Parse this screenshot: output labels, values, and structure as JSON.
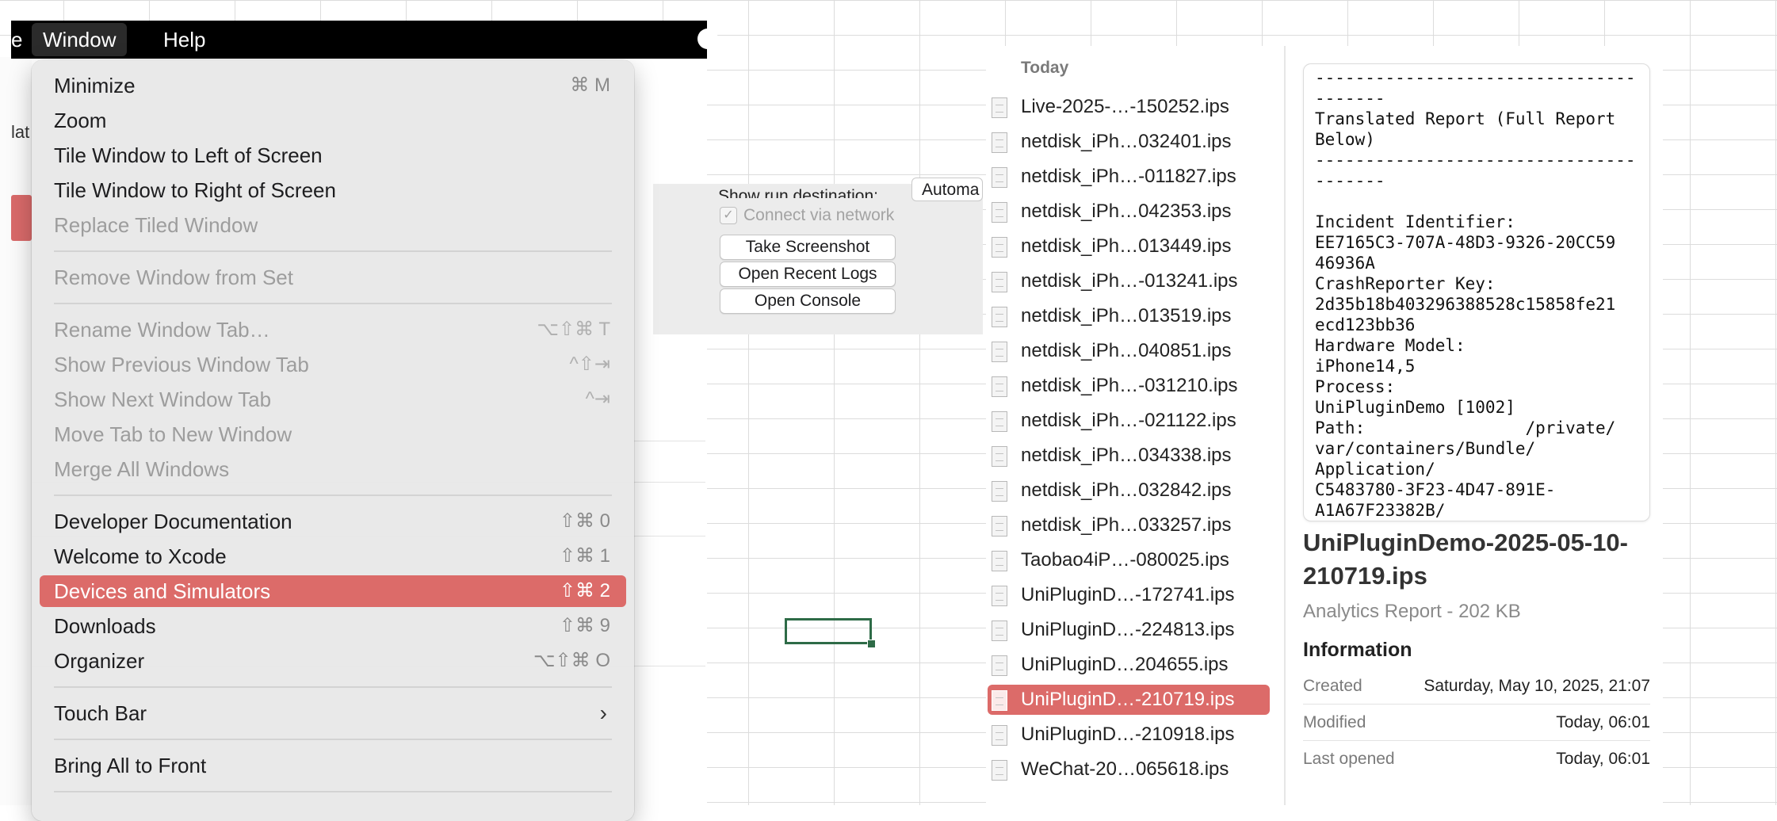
{
  "menubar": {
    "partial_left": "e",
    "window_label": "Window",
    "help_label": "Help"
  },
  "under_window": {
    "partial_label": "lat"
  },
  "device_panel": {
    "run_destination_label": "Show run destination:",
    "run_destination_value": "Automa",
    "connect_label": "Connect via network",
    "buttons": [
      "Take Screenshot",
      "Open Recent Logs",
      "Open Console"
    ]
  },
  "window_menu": {
    "items": [
      {
        "label": "Minimize",
        "shortcut": "⌘ M"
      },
      {
        "label": "Zoom",
        "shortcut": ""
      },
      {
        "label": "Tile Window to Left of Screen",
        "shortcut": ""
      },
      {
        "label": "Tile Window to Right of Screen",
        "shortcut": ""
      },
      {
        "label": "Replace Tiled Window",
        "shortcut": ""
      },
      {
        "label": "Remove Window from Set",
        "shortcut": ""
      },
      {
        "label": "Rename Window Tab…",
        "shortcut": "⌥⇧⌘ T"
      },
      {
        "label": "Show Previous Window Tab",
        "shortcut": "^⇧⇥"
      },
      {
        "label": "Show Next Window Tab",
        "shortcut": "^⇥"
      },
      {
        "label": "Move Tab to New Window",
        "shortcut": ""
      },
      {
        "label": "Merge All Windows",
        "shortcut": ""
      },
      {
        "label": "Developer Documentation",
        "shortcut": "⇧⌘ 0"
      },
      {
        "label": "Welcome to Xcode",
        "shortcut": "⇧⌘ 1"
      },
      {
        "label": "Devices and Simulators",
        "shortcut": "⇧⌘ 2"
      },
      {
        "label": "Downloads",
        "shortcut": "⇧⌘ 9"
      },
      {
        "label": "Organizer",
        "shortcut": "⌥⇧⌘ O"
      },
      {
        "label": "Touch Bar",
        "shortcut": ""
      },
      {
        "label": "Bring All to Front",
        "shortcut": ""
      }
    ]
  },
  "finder": {
    "section_header": "Today",
    "files": [
      "Live-2025-…-150252.ips",
      "netdisk_iPh…032401.ips",
      "netdisk_iPh…-011827.ips",
      "netdisk_iPh…042353.ips",
      "netdisk_iPh…013449.ips",
      "netdisk_iPh…-013241.ips",
      "netdisk_iPh…013519.ips",
      "netdisk_iPh…040851.ips",
      "netdisk_iPh…-031210.ips",
      "netdisk_iPh…-021122.ips",
      "netdisk_iPh…034338.ips",
      "netdisk_iPh…032842.ips",
      "netdisk_iPh…033257.ips",
      "Taobao4iP…-080025.ips",
      "UniPluginD…-172741.ips",
      "UniPluginD…-224813.ips",
      "UniPluginD…204655.ips",
      "UniPluginD…-210719.ips",
      "UniPluginD…-210918.ips",
      "WeChat-20…065618.ips"
    ],
    "selected_index": 17
  },
  "preview": {
    "text": "--------------------------------\n-------\nTranslated Report (Full Report\nBelow)\n--------------------------------\n-------\n\nIncident Identifier:\nEE7165C3-707A-48D3-9326-20CC59\n46936A\nCrashReporter Key:\n2d35b18b403296388528c15858fe21\necd123bb36\nHardware Model:\niPhone14,5\nProcess:\nUniPluginDemo [1002]\nPath:                /private/\nvar/containers/Bundle/\nApplication/\nC5483780-3F23-4D47-891E-\nA1A67F23382B/",
    "file_title": "UniPluginDemo-2025-05-10-210719.ips",
    "subtitle": "Analytics Report - 202 KB",
    "info_heading": "Information",
    "info": [
      {
        "key": "Created",
        "value": "Saturday, May 10, 2025, 21:07"
      },
      {
        "key": "Modified",
        "value": "Today, 06:01"
      },
      {
        "key": "Last opened",
        "value": "Today, 06:01"
      }
    ]
  },
  "colors": {
    "highlight": "#dc6b69",
    "menubar": "#000000",
    "cell_selection": "#2e6b47"
  }
}
